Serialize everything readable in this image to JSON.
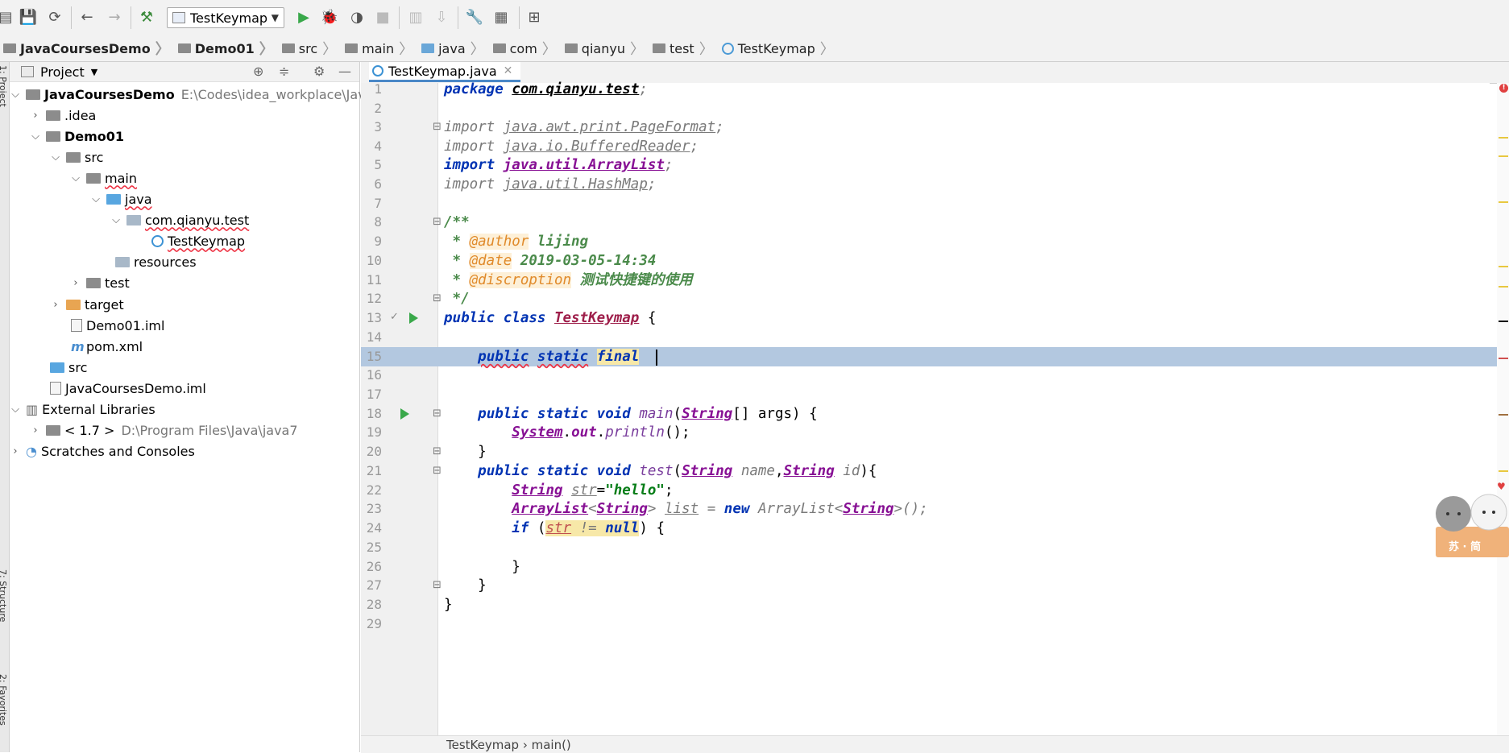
{
  "toolbar": {
    "run_config": "TestKeymap"
  },
  "breadcrumbs": [
    "JavaCoursesDemo",
    "Demo01",
    "src",
    "main",
    "java",
    "com",
    "qianyu",
    "test",
    "TestKeymap"
  ],
  "side_tabs": {
    "project": "1: Project",
    "structure": "7: Structure",
    "favorites": "2: Favorites"
  },
  "project_panel": {
    "title": "Project",
    "tree": [
      {
        "label": "JavaCoursesDemo",
        "path": "E:\\Codes\\idea_workplace\\JavaCo"
      },
      {
        "label": ".idea"
      },
      {
        "label": "Demo01"
      },
      {
        "label": "src"
      },
      {
        "label": "main"
      },
      {
        "label": "java"
      },
      {
        "label": "com.qianyu.test"
      },
      {
        "label": "TestKeymap"
      },
      {
        "label": "resources"
      },
      {
        "label": "test"
      },
      {
        "label": "target"
      },
      {
        "label": "Demo01.iml"
      },
      {
        "label": "pom.xml"
      },
      {
        "label": "src"
      },
      {
        "label": "JavaCoursesDemo.iml"
      },
      {
        "label": "External Libraries"
      },
      {
        "label": "< 1.7 >",
        "path": "D:\\Program Files\\Java\\java7"
      },
      {
        "label": "Scratches and Consoles"
      }
    ]
  },
  "editor": {
    "tab": "TestKeymap.java",
    "line_numbers": [
      "1",
      "2",
      "3",
      "4",
      "5",
      "6",
      "7",
      "8",
      "9",
      "10",
      "11",
      "12",
      "13",
      "14",
      "15",
      "16",
      "17",
      "18",
      "19",
      "20",
      "21",
      "22",
      "23",
      "24",
      "25",
      "26",
      "27",
      "28",
      "29"
    ],
    "cursor_line": 15
  },
  "status_bar": {
    "path": "TestKeymap  ›  main()"
  },
  "mascot_text": "苏 · 简"
}
